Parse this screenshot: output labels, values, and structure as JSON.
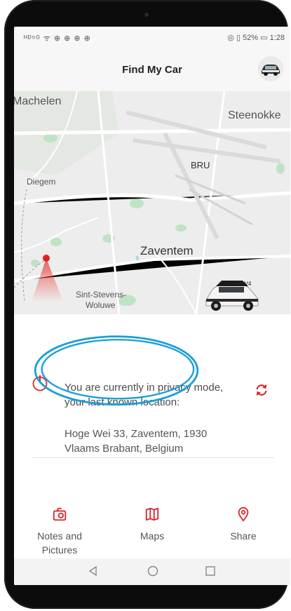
{
  "app": {
    "title": "Find My Car"
  },
  "status": {
    "left": "ᴴᴰ⁵ᴳ ᯤ ⊕ ⊕ ⊕ ⊕",
    "right": "◎ ▯ 52% ▭ 1:28"
  },
  "map": {
    "labels": [
      {
        "name": "machelen",
        "text": "Machelen"
      },
      {
        "name": "steenokkerzeel",
        "text": "Steenokke"
      },
      {
        "name": "bru",
        "text": "BRU"
      },
      {
        "name": "diegem",
        "text": "Diegem"
      },
      {
        "name": "zaventem",
        "text": "Zaventem"
      },
      {
        "name": "sint-stevens",
        "text": "Sint-Stevens-"
      },
      {
        "name": "woluwe",
        "text": "Woluwe"
      }
    ],
    "car_label": "RAV4"
  },
  "info": {
    "message": "You are currently in privacy mode, your last known location:",
    "address": "Hoge Wei 33, Zaventem, 1930 Vlaams Brabant, Belgium"
  },
  "actions": [
    {
      "label": "Notes and Pictures",
      "icon": "notes-camera-icon"
    },
    {
      "label": "Maps",
      "icon": "map-icon"
    },
    {
      "label": "Share",
      "icon": "location-pin-icon"
    }
  ],
  "colors": {
    "accent": "#d9262c",
    "highlight": "#1a9ed6"
  }
}
